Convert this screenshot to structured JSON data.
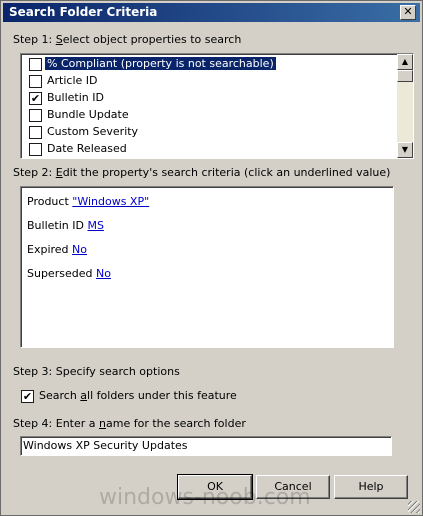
{
  "window": {
    "title": "Search Folder Criteria",
    "close_glyph": "✕"
  },
  "step1": {
    "prefix": "Step 1: ",
    "accel": "S",
    "rest": "elect object properties to search"
  },
  "properties": [
    {
      "label": "% Compliant (property is not searchable)",
      "checked": false,
      "selected": true
    },
    {
      "label": "Article ID",
      "checked": false,
      "selected": false
    },
    {
      "label": "Bulletin ID",
      "checked": true,
      "selected": false
    },
    {
      "label": "Bundle Update",
      "checked": false,
      "selected": false
    },
    {
      "label": "Custom Severity",
      "checked": false,
      "selected": false
    },
    {
      "label": "Date Released",
      "checked": false,
      "selected": false
    }
  ],
  "step2": {
    "prefix": "Step 2: ",
    "accel": "E",
    "rest": "dit the property's search criteria (click an underlined value)"
  },
  "criteria": [
    {
      "label": "Product ",
      "value": "\"Windows XP\""
    },
    {
      "label": "Bulletin ID ",
      "value": "MS"
    },
    {
      "label": "Expired ",
      "value": "No"
    },
    {
      "label": "Superseded ",
      "value": "No"
    }
  ],
  "step3": {
    "label": "Step 3: Specify search options"
  },
  "option": {
    "pre": "Search ",
    "accel": "a",
    "post": "ll folders under this feature",
    "checked": true
  },
  "step4": {
    "pre": "Step 4: Enter a ",
    "accel": "n",
    "post": "ame for the search folder"
  },
  "name_value": "Windows XP Security Updates",
  "buttons": {
    "ok": "OK",
    "cancel": "Cancel",
    "help": "Help"
  },
  "watermark": "windows-noob.com",
  "check_glyph": "✔",
  "scroll": {
    "up": "▲",
    "down": "▼"
  }
}
